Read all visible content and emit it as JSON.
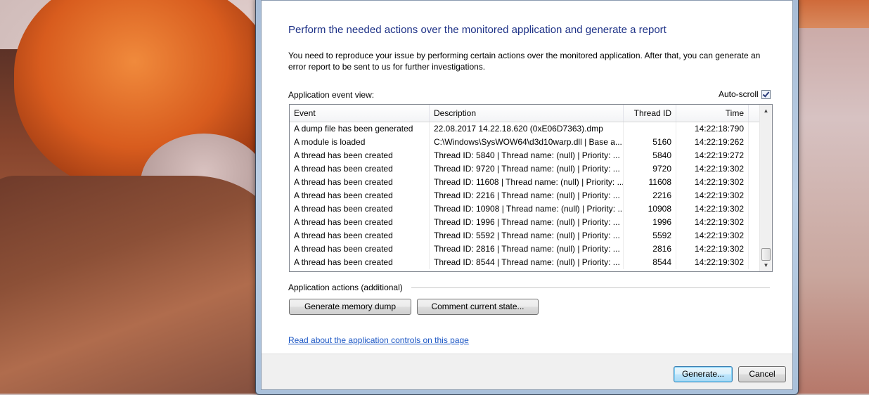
{
  "dialog": {
    "heading": "Perform the needed actions over the monitored application and generate a report",
    "intro": "You need to reproduce your issue by performing certain actions over the monitored application. After that, you can generate an error report to be sent to us for further investigations.",
    "event_view_label": "Application event view:",
    "auto_scroll_label": "Auto-scroll",
    "auto_scroll_checked": true
  },
  "table": {
    "columns": [
      "Event",
      "Description",
      "Thread ID",
      "Time"
    ],
    "rows": [
      {
        "event": "A dump file has been generated",
        "description": "22.08.2017 14.22.18.620 (0xE06D7363).dmp",
        "thread_id": "",
        "time": "14:22:18:790"
      },
      {
        "event": "A module is loaded",
        "description": "C:\\Windows\\SysWOW64\\d3d10warp.dll | Base a...",
        "thread_id": "5160",
        "time": "14:22:19:262"
      },
      {
        "event": "A thread has been created",
        "description": "Thread ID: 5840 | Thread name: (null) | Priority: ...",
        "thread_id": "5840",
        "time": "14:22:19:272"
      },
      {
        "event": "A thread has been created",
        "description": "Thread ID: 9720 | Thread name: (null) | Priority: ...",
        "thread_id": "9720",
        "time": "14:22:19:302"
      },
      {
        "event": "A thread has been created",
        "description": "Thread ID: 11608 | Thread name: (null) | Priority: ...",
        "thread_id": "11608",
        "time": "14:22:19:302"
      },
      {
        "event": "A thread has been created",
        "description": "Thread ID: 2216 | Thread name: (null) | Priority: ...",
        "thread_id": "2216",
        "time": "14:22:19:302"
      },
      {
        "event": "A thread has been created",
        "description": "Thread ID: 10908 | Thread name: (null) | Priority: ...",
        "thread_id": "10908",
        "time": "14:22:19:302"
      },
      {
        "event": "A thread has been created",
        "description": "Thread ID: 1996 | Thread name: (null) | Priority: ...",
        "thread_id": "1996",
        "time": "14:22:19:302"
      },
      {
        "event": "A thread has been created",
        "description": "Thread ID: 5592 | Thread name: (null) | Priority: ...",
        "thread_id": "5592",
        "time": "14:22:19:302"
      },
      {
        "event": "A thread has been created",
        "description": "Thread ID: 2816 | Thread name: (null) | Priority: ...",
        "thread_id": "2816",
        "time": "14:22:19:302"
      },
      {
        "event": "A thread has been created",
        "description": "Thread ID: 8544 | Thread name: (null) | Priority: ...",
        "thread_id": "8544",
        "time": "14:22:19:302"
      }
    ]
  },
  "actions": {
    "label": "Application actions (additional)",
    "dump_button": "Generate memory dump",
    "comment_button": "Comment current state...",
    "help_link": "Read about the application controls on this page"
  },
  "footer": {
    "generate_button": "Generate...",
    "cancel_button": "Cancel"
  }
}
